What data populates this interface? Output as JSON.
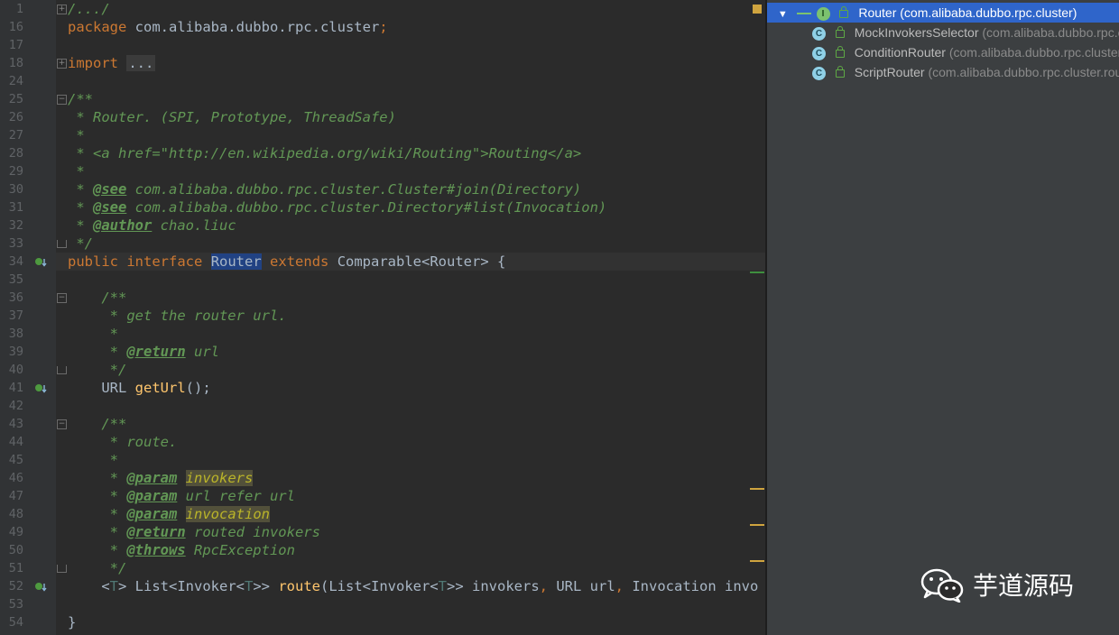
{
  "editor": {
    "line_numbers": [
      "1",
      "16",
      "17",
      "18",
      "24",
      "25",
      "26",
      "27",
      "28",
      "29",
      "30",
      "31",
      "32",
      "33",
      "34",
      "35",
      "36",
      "37",
      "38",
      "39",
      "40",
      "41",
      "42",
      "43",
      "44",
      "45",
      "46",
      "47",
      "48",
      "49",
      "50",
      "51",
      "52",
      "53",
      "54"
    ],
    "lines": [
      [
        "/.../"
      ],
      [
        "package",
        " com.alibaba.dubbo.rpc.cluster",
        ";"
      ],
      [],
      [
        "import",
        " ",
        "..."
      ],
      [],
      [
        "/**"
      ],
      [
        " * Router. (SPI, Prototype, ThreadSafe)"
      ],
      [
        " *"
      ],
      [
        " * <a href=\"http://en.wikipedia.org/wiki/Routing\">Routing</a>"
      ],
      [
        " *"
      ],
      [
        " * ",
        "@see",
        " com.alibaba.dubbo.rpc.cluster.Cluster",
        "#join",
        "(Directory)"
      ],
      [
        " * ",
        "@see",
        " com.alibaba.dubbo.rpc.cluster.Directory",
        "#list",
        "(Invocation)"
      ],
      [
        " * ",
        "@author",
        " chao.liuc"
      ],
      [
        " */"
      ],
      [
        "public",
        " ",
        "interface",
        " ",
        "Router",
        " ",
        "extends",
        " Comparable<",
        "Router",
        "> {"
      ],
      [],
      [
        "    /**"
      ],
      [
        "     * get the router url."
      ],
      [
        "     *"
      ],
      [
        "     * ",
        "@return",
        " url"
      ],
      [
        "     */"
      ],
      [
        "    URL ",
        "getUrl",
        "();"
      ],
      [],
      [
        "    /**"
      ],
      [
        "     * route."
      ],
      [
        "     *"
      ],
      [
        "     * ",
        "@param",
        " ",
        "invokers"
      ],
      [
        "     * ",
        "@param",
        " url refer url"
      ],
      [
        "     * ",
        "@param",
        " ",
        "invocation"
      ],
      [
        "     * ",
        "@return",
        " routed invokers"
      ],
      [
        "     * ",
        "@throws",
        " RpcException"
      ],
      [
        "     */"
      ],
      [
        "    <",
        "T",
        "> List<Invoker<",
        "T",
        ">> ",
        "route",
        "(List<Invoker<",
        "T",
        ">> invokers",
        ", ",
        "URL url",
        ", ",
        "Invocation invo"
      ],
      [],
      [
        "}"
      ]
    ]
  },
  "tree": {
    "root": {
      "name": "Router",
      "package": "(com.alibaba.dubbo.rpc.cluster)",
      "icon": "interface-icon",
      "expanded": true
    },
    "children": [
      {
        "name": "MockInvokersSelector",
        "package": "(com.alibaba.dubbo.rpc.cluster.router)",
        "icon": "class-icon"
      },
      {
        "name": "ConditionRouter",
        "package": "(com.alibaba.dubbo.rpc.cluster.router.condition)",
        "icon": "class-icon"
      },
      {
        "name": "ScriptRouter",
        "package": "(com.alibaba.dubbo.rpc.cluster.router.script)",
        "icon": "class-icon"
      }
    ]
  },
  "watermark": {
    "text": "芋道源码",
    "icon": "wechat-icon"
  },
  "colors": {
    "keyword": "#cc7832",
    "comment": "#629755",
    "method": "#ffc66d",
    "selection": "#214283",
    "tree_selection": "#2f65ca"
  }
}
